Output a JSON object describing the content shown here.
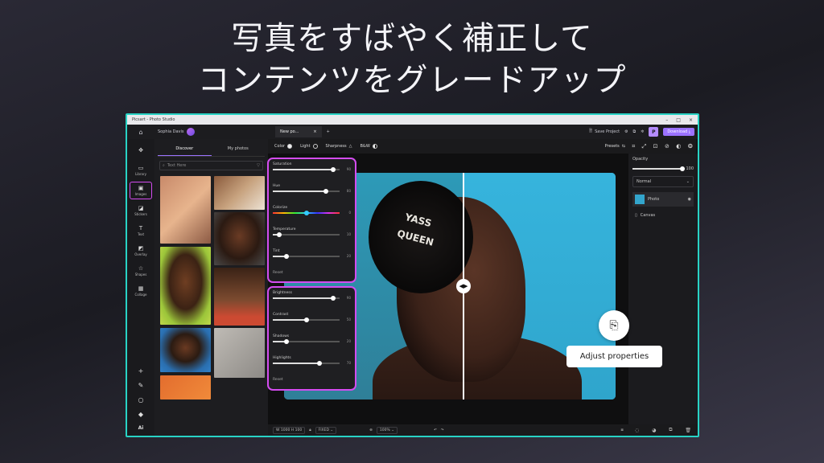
{
  "headline": {
    "line1": "写真をすばやく補正して",
    "line2": "コンテンツをグレードアップ"
  },
  "window": {
    "title": "Picsart - Photo Studio",
    "controls": [
      "–",
      "□",
      "×"
    ]
  },
  "topbar": {
    "user_name": "Sophia Davis",
    "tab_label": "New po...",
    "tab_close": "×",
    "tab_add": "+",
    "save_label": "Save Project",
    "plan_badge": "P",
    "download_label": "Download"
  },
  "leftrail": {
    "items": [
      {
        "label": "Library",
        "icon": "folder"
      },
      {
        "label": "Images",
        "icon": "image"
      },
      {
        "label": "Stickers",
        "icon": "sticker"
      },
      {
        "label": "Text",
        "icon": "text"
      },
      {
        "label": "Overlay",
        "icon": "overlay"
      },
      {
        "label": "Shapes",
        "icon": "star"
      },
      {
        "label": "Collage",
        "icon": "collage"
      }
    ],
    "tools": [
      "+",
      "brush",
      "circle",
      "eraser",
      "Ai"
    ],
    "ai_label": "Ai"
  },
  "panel": {
    "tabs": [
      "Discover",
      "My photos"
    ],
    "search_placeholder": "Text Here"
  },
  "adjust_toolbar": {
    "items": [
      "Color",
      "Light",
      "Sharpness",
      "B&W"
    ],
    "presets": "Presets"
  },
  "color_sliders": [
    {
      "label": "Saturation",
      "value": 90
    },
    {
      "label": "Hue",
      "value": 80
    },
    {
      "label": "Colorize",
      "value": 0
    },
    {
      "label": "Temperature",
      "value": 10
    },
    {
      "label": "Tint",
      "value": 20
    }
  ],
  "light_sliders": [
    {
      "label": "Brightness",
      "value": 90
    },
    {
      "label": "Contrast",
      "value": 50
    },
    {
      "label": "Shadows",
      "value": 20
    },
    {
      "label": "Highlights",
      "value": 70
    }
  ],
  "reset_label": "Reset",
  "photo_text": {
    "line1": "YASS",
    "line2": "QUEEN"
  },
  "tooltip": {
    "label": "Adjust properties"
  },
  "rightpanel": {
    "opacity_label": "Opacity",
    "opacity_value": "100",
    "blend_mode": "Normal",
    "layers": [
      "Photo",
      "Canvas"
    ]
  },
  "bottombar": {
    "w_label": "W",
    "w_value": "1000",
    "h_label": "H",
    "h_value": "100",
    "fixed": "FIXED",
    "zoom": "100%"
  },
  "colors": {
    "accent": "#9b72ff",
    "highlight_border": "#d44cf0",
    "window_border": "#28d3c5"
  }
}
